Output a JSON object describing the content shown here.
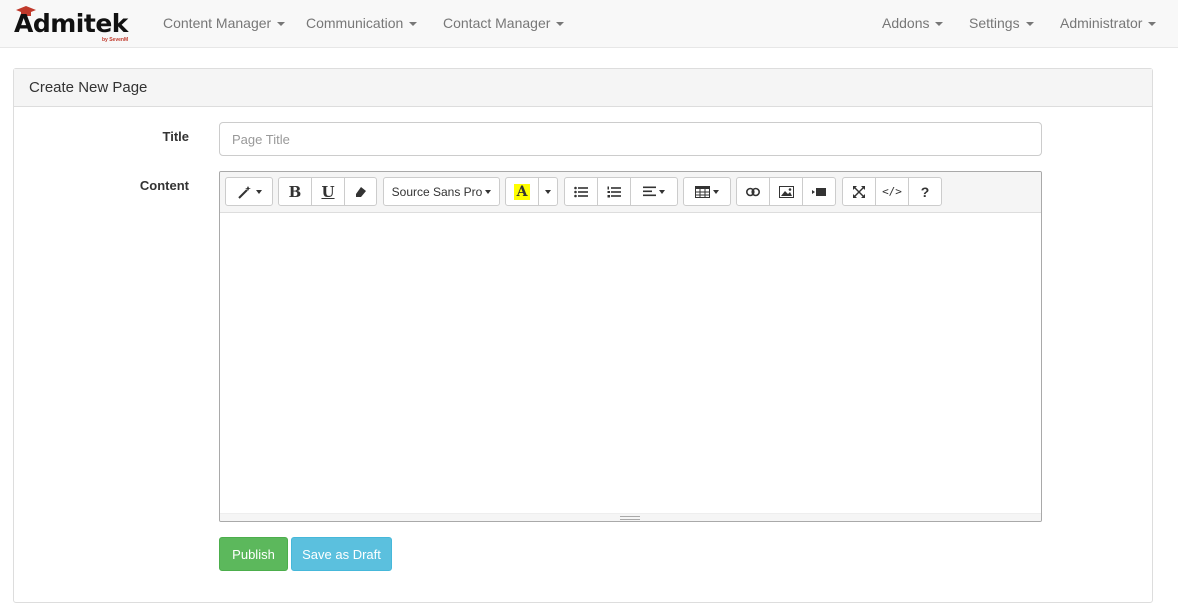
{
  "brand": {
    "name": "Admitek",
    "sub": "by SevenM"
  },
  "nav": {
    "left": [
      {
        "label": "Content Manager"
      },
      {
        "label": "Communication"
      },
      {
        "label": "Contact Manager"
      }
    ],
    "right": [
      {
        "label": "Addons"
      },
      {
        "label": "Settings"
      },
      {
        "label": "Administrator"
      }
    ]
  },
  "panel": {
    "title": "Create New Page"
  },
  "form": {
    "title_label": "Title",
    "title_placeholder": "Page Title",
    "title_value": "",
    "content_label": "Content"
  },
  "toolbar": {
    "font_name": "Source Sans Pro",
    "bold": "B",
    "underline": "U",
    "help": "?",
    "highlight_letter": "A",
    "highlight_color": "#ffff00"
  },
  "actions": {
    "publish": "Publish",
    "draft": "Save as Draft"
  },
  "colors": {
    "publish": "#5cb85c",
    "draft": "#5bc0de"
  }
}
